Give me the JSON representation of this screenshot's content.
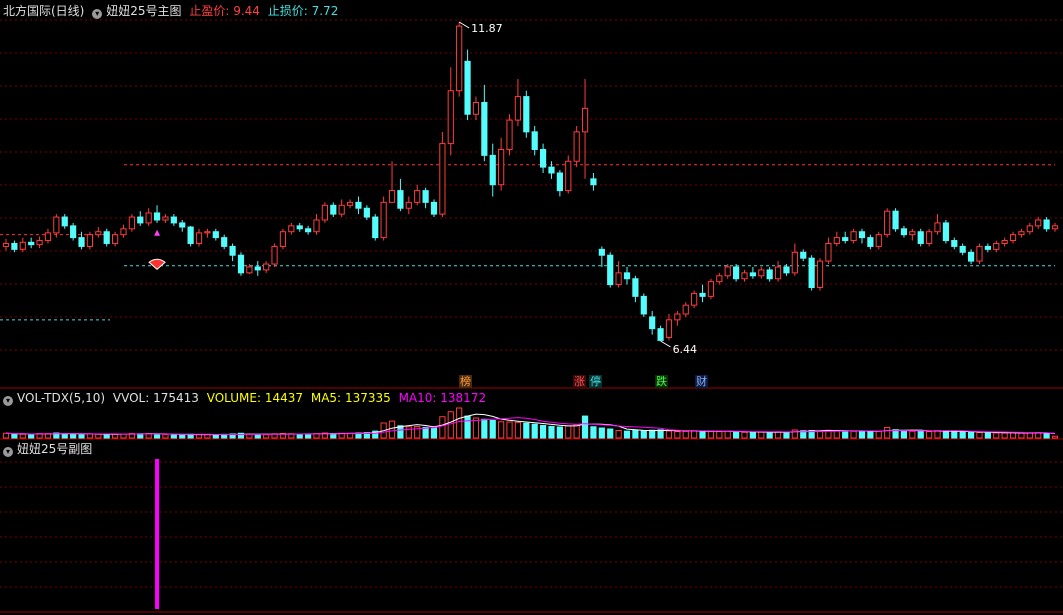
{
  "main_header": {
    "stock_name": "北方国际(日线)",
    "indicator_name": "妞妞25号主图",
    "take_profit_label": "止盈价:",
    "take_profit_value": "9.44",
    "stop_loss_label": "止损价:",
    "stop_loss_value": "7.72"
  },
  "vol_header": {
    "indicator": "VOL-TDX(5,10)",
    "vvol_label": "VVOL:",
    "vvol_value": "175413",
    "volume_label": "VOLUME:",
    "volume_value": "14437",
    "ma5_label": "MA5:",
    "ma5_value": "137335",
    "ma10_label": "MA10:",
    "ma10_value": "138172"
  },
  "sub_header": {
    "indicator_name": "妞妞25号副图"
  },
  "markers": [
    {
      "text": "榜",
      "color": "#ff9a30",
      "bg": "#4a2a10"
    },
    {
      "text": "涨",
      "color": "#ff5050",
      "bg": "#3a0a0a"
    },
    {
      "text": "停",
      "color": "#40e0e0",
      "bg": "#0a3030"
    },
    {
      "text": "跌",
      "color": "#40ff40",
      "bg": "#0a300a"
    },
    {
      "text": "财",
      "color": "#80b0ff",
      "bg": "#101a40"
    }
  ],
  "colors": {
    "up": "#ff3c3c",
    "down": "#54fcfc",
    "grid": "#7a0000",
    "ma5": "#ffffff",
    "ma10": "#ff00ff",
    "volume_text": "#ffff00",
    "sub_bar": "#ff00ff"
  },
  "chart_data": {
    "type": "candlestick",
    "price_high_label": "11.87",
    "price_low_label": "6.44",
    "take_profit_line": 9.44,
    "stop_loss_line": 7.72,
    "candles": [
      [
        8.05,
        8.1,
        8.18,
        7.98
      ],
      [
        8.1,
        8.0,
        8.15,
        7.95
      ],
      [
        8.0,
        8.12,
        8.2,
        7.95
      ],
      [
        8.12,
        8.08,
        8.2,
        8.02
      ],
      [
        8.08,
        8.15,
        8.22,
        8.02
      ],
      [
        8.15,
        8.28,
        8.35,
        8.1
      ],
      [
        8.28,
        8.55,
        8.6,
        8.2
      ],
      [
        8.55,
        8.4,
        8.6,
        8.35
      ],
      [
        8.4,
        8.2,
        8.45,
        8.15
      ],
      [
        8.2,
        8.05,
        8.3,
        8.0
      ],
      [
        8.05,
        8.25,
        8.3,
        8.0
      ],
      [
        8.25,
        8.3,
        8.38,
        8.2
      ],
      [
        8.3,
        8.1,
        8.35,
        8.05
      ],
      [
        8.1,
        8.25,
        8.3,
        8.05
      ],
      [
        8.25,
        8.35,
        8.42,
        8.2
      ],
      [
        8.35,
        8.55,
        8.6,
        8.3
      ],
      [
        8.55,
        8.45,
        8.65,
        8.4
      ],
      [
        8.45,
        8.62,
        8.7,
        8.4
      ],
      [
        8.62,
        8.5,
        8.75,
        8.45
      ],
      [
        8.5,
        8.55,
        8.6,
        8.45
      ],
      [
        8.55,
        8.45,
        8.6,
        8.4
      ],
      [
        8.45,
        8.38,
        8.5,
        8.3
      ],
      [
        8.38,
        8.1,
        8.4,
        8.05
      ],
      [
        8.1,
        8.28,
        8.35,
        8.05
      ],
      [
        8.28,
        8.3,
        8.35,
        8.2
      ],
      [
        8.3,
        8.2,
        8.35,
        8.15
      ],
      [
        8.2,
        8.05,
        8.25,
        8.0
      ],
      [
        8.05,
        7.9,
        8.1,
        7.8
      ],
      [
        7.9,
        7.6,
        7.95,
        7.55
      ],
      [
        7.6,
        7.7,
        7.75,
        7.58
      ],
      [
        7.7,
        7.65,
        7.8,
        7.55
      ],
      [
        7.65,
        7.75,
        7.8,
        7.6
      ],
      [
        7.75,
        8.05,
        8.1,
        7.7
      ],
      [
        8.05,
        8.3,
        8.35,
        8.0
      ],
      [
        8.3,
        8.4,
        8.45,
        8.25
      ],
      [
        8.4,
        8.35,
        8.45,
        8.3
      ],
      [
        8.35,
        8.3,
        8.4,
        8.25
      ],
      [
        8.3,
        8.5,
        8.6,
        8.25
      ],
      [
        8.5,
        8.75,
        8.8,
        8.45
      ],
      [
        8.75,
        8.6,
        8.8,
        8.55
      ],
      [
        8.6,
        8.75,
        8.85,
        8.55
      ],
      [
        8.75,
        8.8,
        8.85,
        8.7
      ],
      [
        8.8,
        8.7,
        8.9,
        8.6
      ],
      [
        8.7,
        8.55,
        8.75,
        8.5
      ],
      [
        8.55,
        8.2,
        8.6,
        8.15
      ],
      [
        8.2,
        8.8,
        8.9,
        8.15
      ],
      [
        8.8,
        9.0,
        9.5,
        8.8
      ],
      [
        9.0,
        8.7,
        9.2,
        8.65
      ],
      [
        8.7,
        8.8,
        8.9,
        8.6
      ],
      [
        8.8,
        9.0,
        9.1,
        8.75
      ],
      [
        9.0,
        8.8,
        9.05,
        8.7
      ],
      [
        8.8,
        8.6,
        8.85,
        8.55
      ],
      [
        8.6,
        9.8,
        10.0,
        8.55
      ],
      [
        9.8,
        10.7,
        11.1,
        9.6
      ],
      [
        10.7,
        11.8,
        11.87,
        10.6
      ],
      [
        11.2,
        10.3,
        11.4,
        10.2
      ],
      [
        10.3,
        10.5,
        10.6,
        10.2
      ],
      [
        10.5,
        9.6,
        10.8,
        9.5
      ],
      [
        9.6,
        9.1,
        9.8,
        8.9
      ],
      [
        9.1,
        9.7,
        9.9,
        9.0
      ],
      [
        9.7,
        10.2,
        10.3,
        9.6
      ],
      [
        10.2,
        10.6,
        10.9,
        10.1
      ],
      [
        10.6,
        10.0,
        10.7,
        9.9
      ],
      [
        10.0,
        9.7,
        10.1,
        9.6
      ],
      [
        9.7,
        9.4,
        9.8,
        9.3
      ],
      [
        9.4,
        9.3,
        9.5,
        9.2
      ],
      [
        9.3,
        9.0,
        9.35,
        8.9
      ],
      [
        9.0,
        9.5,
        9.6,
        8.95
      ],
      [
        9.5,
        10.0,
        10.1,
        9.4
      ],
      [
        10.0,
        10.4,
        10.9,
        9.2
      ],
      [
        9.2,
        9.1,
        9.3,
        9.0
      ],
      [
        8.0,
        7.9,
        8.05,
        7.7
      ],
      [
        7.9,
        7.4,
        7.95,
        7.35
      ],
      [
        7.4,
        7.6,
        7.8,
        7.35
      ],
      [
        7.6,
        7.5,
        7.7,
        7.4
      ],
      [
        7.5,
        7.2,
        7.55,
        7.1
      ],
      [
        7.2,
        6.9,
        7.25,
        6.85
      ],
      [
        6.85,
        6.65,
        6.95,
        6.55
      ],
      [
        6.65,
        6.45,
        6.7,
        6.44
      ],
      [
        6.5,
        6.8,
        6.9,
        6.45
      ],
      [
        6.8,
        6.9,
        6.95,
        6.7
      ],
      [
        6.9,
        7.05,
        7.1,
        6.85
      ],
      [
        7.05,
        7.25,
        7.3,
        7.0
      ],
      [
        7.25,
        7.2,
        7.4,
        7.1
      ],
      [
        7.2,
        7.45,
        7.5,
        7.15
      ],
      [
        7.45,
        7.55,
        7.6,
        7.4
      ],
      [
        7.55,
        7.7,
        7.75,
        7.5
      ],
      [
        7.7,
        7.5,
        7.75,
        7.45
      ],
      [
        7.5,
        7.6,
        7.65,
        7.45
      ],
      [
        7.6,
        7.55,
        7.7,
        7.5
      ],
      [
        7.55,
        7.65,
        7.7,
        7.5
      ],
      [
        7.65,
        7.5,
        7.7,
        7.45
      ],
      [
        7.5,
        7.7,
        7.8,
        7.45
      ],
      [
        7.7,
        7.6,
        7.75,
        7.55
      ],
      [
        7.6,
        7.95,
        8.1,
        7.55
      ],
      [
        7.95,
        7.85,
        8.0,
        7.8
      ],
      [
        7.85,
        7.35,
        7.9,
        7.3
      ],
      [
        7.35,
        7.8,
        7.85,
        7.3
      ],
      [
        7.8,
        8.1,
        8.2,
        7.75
      ],
      [
        8.1,
        8.2,
        8.3,
        8.05
      ],
      [
        8.2,
        8.15,
        8.3,
        8.1
      ],
      [
        8.15,
        8.3,
        8.35,
        8.1
      ],
      [
        8.3,
        8.2,
        8.35,
        8.1
      ],
      [
        8.2,
        8.05,
        8.25,
        8.0
      ],
      [
        8.05,
        8.25,
        8.3,
        8.0
      ],
      [
        8.25,
        8.65,
        8.7,
        8.2
      ],
      [
        8.65,
        8.35,
        8.7,
        8.3
      ],
      [
        8.35,
        8.25,
        8.4,
        8.2
      ],
      [
        8.25,
        8.3,
        8.35,
        8.15
      ],
      [
        8.3,
        8.1,
        8.35,
        8.05
      ],
      [
        8.1,
        8.3,
        8.35,
        8.05
      ],
      [
        8.3,
        8.45,
        8.6,
        8.25
      ],
      [
        8.45,
        8.15,
        8.5,
        8.1
      ],
      [
        8.15,
        8.05,
        8.2,
        8.0
      ],
      [
        8.05,
        7.95,
        8.1,
        7.9
      ],
      [
        7.95,
        7.8,
        8.0,
        7.75
      ],
      [
        7.8,
        8.05,
        8.1,
        7.75
      ],
      [
        8.05,
        8.0,
        8.1,
        7.95
      ],
      [
        8.0,
        8.1,
        8.15,
        7.95
      ],
      [
        8.1,
        8.15,
        8.2,
        8.05
      ],
      [
        8.15,
        8.25,
        8.3,
        8.1
      ],
      [
        8.25,
        8.3,
        8.35,
        8.2
      ],
      [
        8.3,
        8.4,
        8.45,
        8.25
      ],
      [
        8.4,
        8.5,
        8.55,
        8.35
      ],
      [
        8.5,
        8.35,
        8.55,
        8.3
      ],
      [
        8.35,
        8.4,
        8.45,
        8.3
      ]
    ],
    "volumes": [
      [
        38000,
        1
      ],
      [
        32000,
        0
      ],
      [
        30000,
        1
      ],
      [
        28000,
        0
      ],
      [
        35000,
        1
      ],
      [
        36000,
        1
      ],
      [
        40000,
        0
      ],
      [
        34000,
        0
      ],
      [
        30000,
        0
      ],
      [
        28000,
        0
      ],
      [
        33000,
        1
      ],
      [
        31000,
        1
      ],
      [
        29000,
        0
      ],
      [
        30000,
        1
      ],
      [
        32000,
        1
      ],
      [
        36000,
        1
      ],
      [
        34000,
        0
      ],
      [
        35000,
        1
      ],
      [
        30000,
        0
      ],
      [
        28000,
        1
      ],
      [
        26000,
        0
      ],
      [
        25000,
        0
      ],
      [
        30000,
        0
      ],
      [
        28000,
        1
      ],
      [
        27000,
        1
      ],
      [
        26000,
        0
      ],
      [
        29000,
        0
      ],
      [
        32000,
        0
      ],
      [
        38000,
        0
      ],
      [
        30000,
        1
      ],
      [
        28000,
        0
      ],
      [
        27000,
        1
      ],
      [
        33000,
        1
      ],
      [
        36000,
        1
      ],
      [
        34000,
        1
      ],
      [
        31000,
        0
      ],
      [
        30000,
        0
      ],
      [
        35000,
        1
      ],
      [
        40000,
        1
      ],
      [
        36000,
        0
      ],
      [
        38000,
        1
      ],
      [
        37000,
        1
      ],
      [
        39000,
        0
      ],
      [
        42000,
        0
      ],
      [
        55000,
        0
      ],
      [
        120000,
        1
      ],
      [
        135000,
        1
      ],
      [
        98000,
        0
      ],
      [
        90000,
        1
      ],
      [
        92000,
        1
      ],
      [
        85000,
        0
      ],
      [
        80000,
        0
      ],
      [
        170000,
        1
      ],
      [
        210000,
        1
      ],
      [
        240000,
        1
      ],
      [
        175413,
        0
      ],
      [
        160000,
        1
      ],
      [
        150000,
        0
      ],
      [
        140000,
        0
      ],
      [
        130000,
        1
      ],
      [
        128000,
        1
      ],
      [
        125000,
        1
      ],
      [
        118000,
        0
      ],
      [
        110000,
        0
      ],
      [
        100000,
        0
      ],
      [
        92000,
        0
      ],
      [
        88000,
        0
      ],
      [
        96000,
        1
      ],
      [
        108000,
        1
      ],
      [
        175413,
        0
      ],
      [
        90000,
        0
      ],
      [
        80000,
        0
      ],
      [
        72000,
        0
      ],
      [
        60000,
        1
      ],
      [
        55000,
        0
      ],
      [
        60000,
        0
      ],
      [
        58000,
        0
      ],
      [
        62000,
        0
      ],
      [
        65000,
        0
      ],
      [
        56000,
        1
      ],
      [
        52000,
        1
      ],
      [
        54000,
        1
      ],
      [
        58000,
        1
      ],
      [
        50000,
        0
      ],
      [
        55000,
        1
      ],
      [
        52000,
        1
      ],
      [
        56000,
        1
      ],
      [
        48000,
        0
      ],
      [
        46000,
        1
      ],
      [
        44000,
        0
      ],
      [
        47000,
        1
      ],
      [
        45000,
        0
      ],
      [
        50000,
        1
      ],
      [
        46000,
        0
      ],
      [
        64000,
        1
      ],
      [
        58000,
        0
      ],
      [
        60000,
        0
      ],
      [
        56000,
        1
      ],
      [
        62000,
        1
      ],
      [
        58000,
        1
      ],
      [
        56000,
        0
      ],
      [
        54000,
        1
      ],
      [
        52000,
        0
      ],
      [
        50000,
        0
      ],
      [
        55000,
        1
      ],
      [
        84000,
        1
      ],
      [
        66000,
        0
      ],
      [
        58000,
        0
      ],
      [
        54000,
        1
      ],
      [
        56000,
        0
      ],
      [
        52000,
        1
      ],
      [
        60000,
        1
      ],
      [
        54000,
        0
      ],
      [
        50000,
        0
      ],
      [
        48000,
        0
      ],
      [
        46000,
        0
      ],
      [
        44000,
        1
      ],
      [
        42000,
        0
      ],
      [
        40000,
        1
      ],
      [
        41000,
        1
      ],
      [
        42000,
        1
      ],
      [
        40000,
        1
      ],
      [
        41000,
        1
      ],
      [
        43000,
        1
      ],
      [
        39000,
        0
      ],
      [
        14437,
        1
      ]
    ],
    "sub_values": [
      {
        "index": 15,
        "value": 1
      }
    ]
  }
}
